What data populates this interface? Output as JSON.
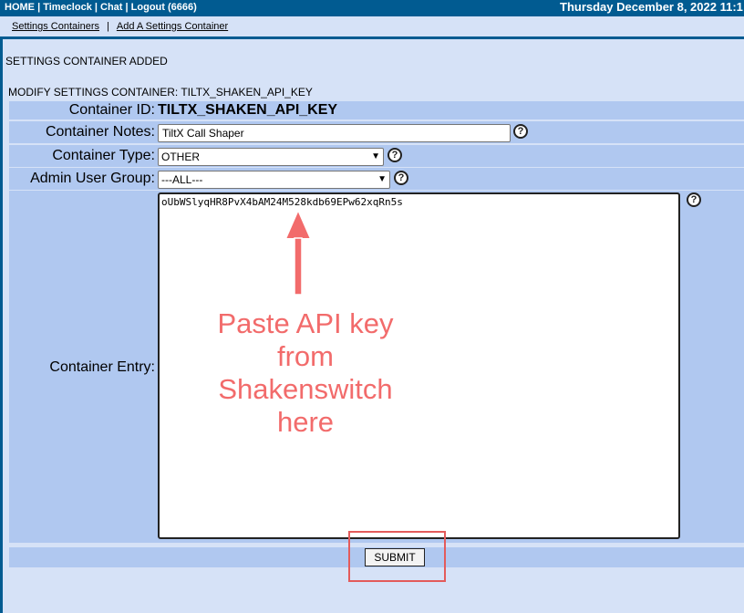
{
  "topnav": {
    "home": "HOME",
    "timeclock": "Timeclock",
    "chat": "Chat",
    "logout": "Logout (6666)",
    "datetime": "Thursday December 8, 2022 11:1"
  },
  "subnav": {
    "settings_containers": "Settings Containers",
    "add_container": "Add A Settings Container"
  },
  "status_message": "SETTINGS CONTAINER ADDED",
  "form": {
    "title": "MODIFY SETTINGS CONTAINER: TILTX_SHAKEN_API_KEY",
    "container_id_label": "Container ID:",
    "container_id_value": "TILTX_SHAKEN_API_KEY",
    "notes_label": "Container Notes:",
    "notes_value": "TiltX Call Shaper",
    "type_label": "Container Type:",
    "type_value": "OTHER",
    "group_label": "Admin User Group:",
    "group_value": "---ALL---",
    "entry_label": "Container Entry:",
    "entry_value": "oUbWSlyqHR8PvX4bAM24M528kdb69EPw62xqRn5s",
    "submit_label": "SUBMIT"
  },
  "annotation": {
    "line1": "Paste API key",
    "line2": "from",
    "line3": "Shakenswitch",
    "line4": "here"
  },
  "colors": {
    "nav_bar": "#015b91",
    "page_bg": "#d6e2f7",
    "row_bg": "#b0c8f0",
    "annotation": "#f26b6b"
  }
}
